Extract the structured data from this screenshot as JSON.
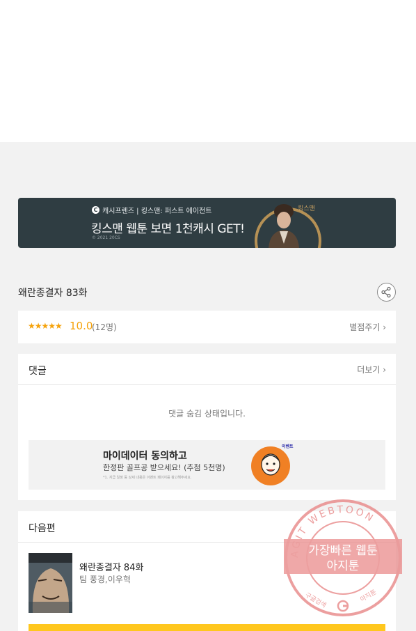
{
  "banner": {
    "brand": "캐시프렌즈 | 킹스맨: 퍼스트 에이전트",
    "headline": "킹스맨 웹툰 보면 1천캐시 GET!",
    "copyright": "© 2021 20CS",
    "logo_text": "킹스맨"
  },
  "episode": {
    "title": "왜란종결자 83화"
  },
  "rating": {
    "stars": "★★★★★",
    "score": "10.0",
    "count": "(12명)",
    "rate_link": "별점주기 ›"
  },
  "comments": {
    "title": "댓글",
    "more_link": "더보기 ›",
    "hidden_message": "댓글 숨김 상태입니다."
  },
  "ad": {
    "title": "마이데이터 동의하고",
    "subtitle": "한정판 골프공 받으세요! (추첨 5천명)",
    "fine_print": "*1. 지급 일정 등 상세 내용은 이벤트 페이지를 참고해주세요.",
    "tag": "이벤트"
  },
  "next": {
    "header": "다음편",
    "title": "왜란종결자 84화",
    "authors": "팀 풍경,이우혁"
  },
  "watermark": {
    "ring_text": "AGIT WEBTOON",
    "line1": "가장빠른 웹툰",
    "line2": "아지툰",
    "foot_left": "구글검색",
    "foot_right": "아지툰"
  },
  "colors": {
    "accent_star": "#f5a20a",
    "banner_bg": "#2f3d42",
    "read_button": "#ffc71e",
    "watermark": "#e98a8a"
  }
}
